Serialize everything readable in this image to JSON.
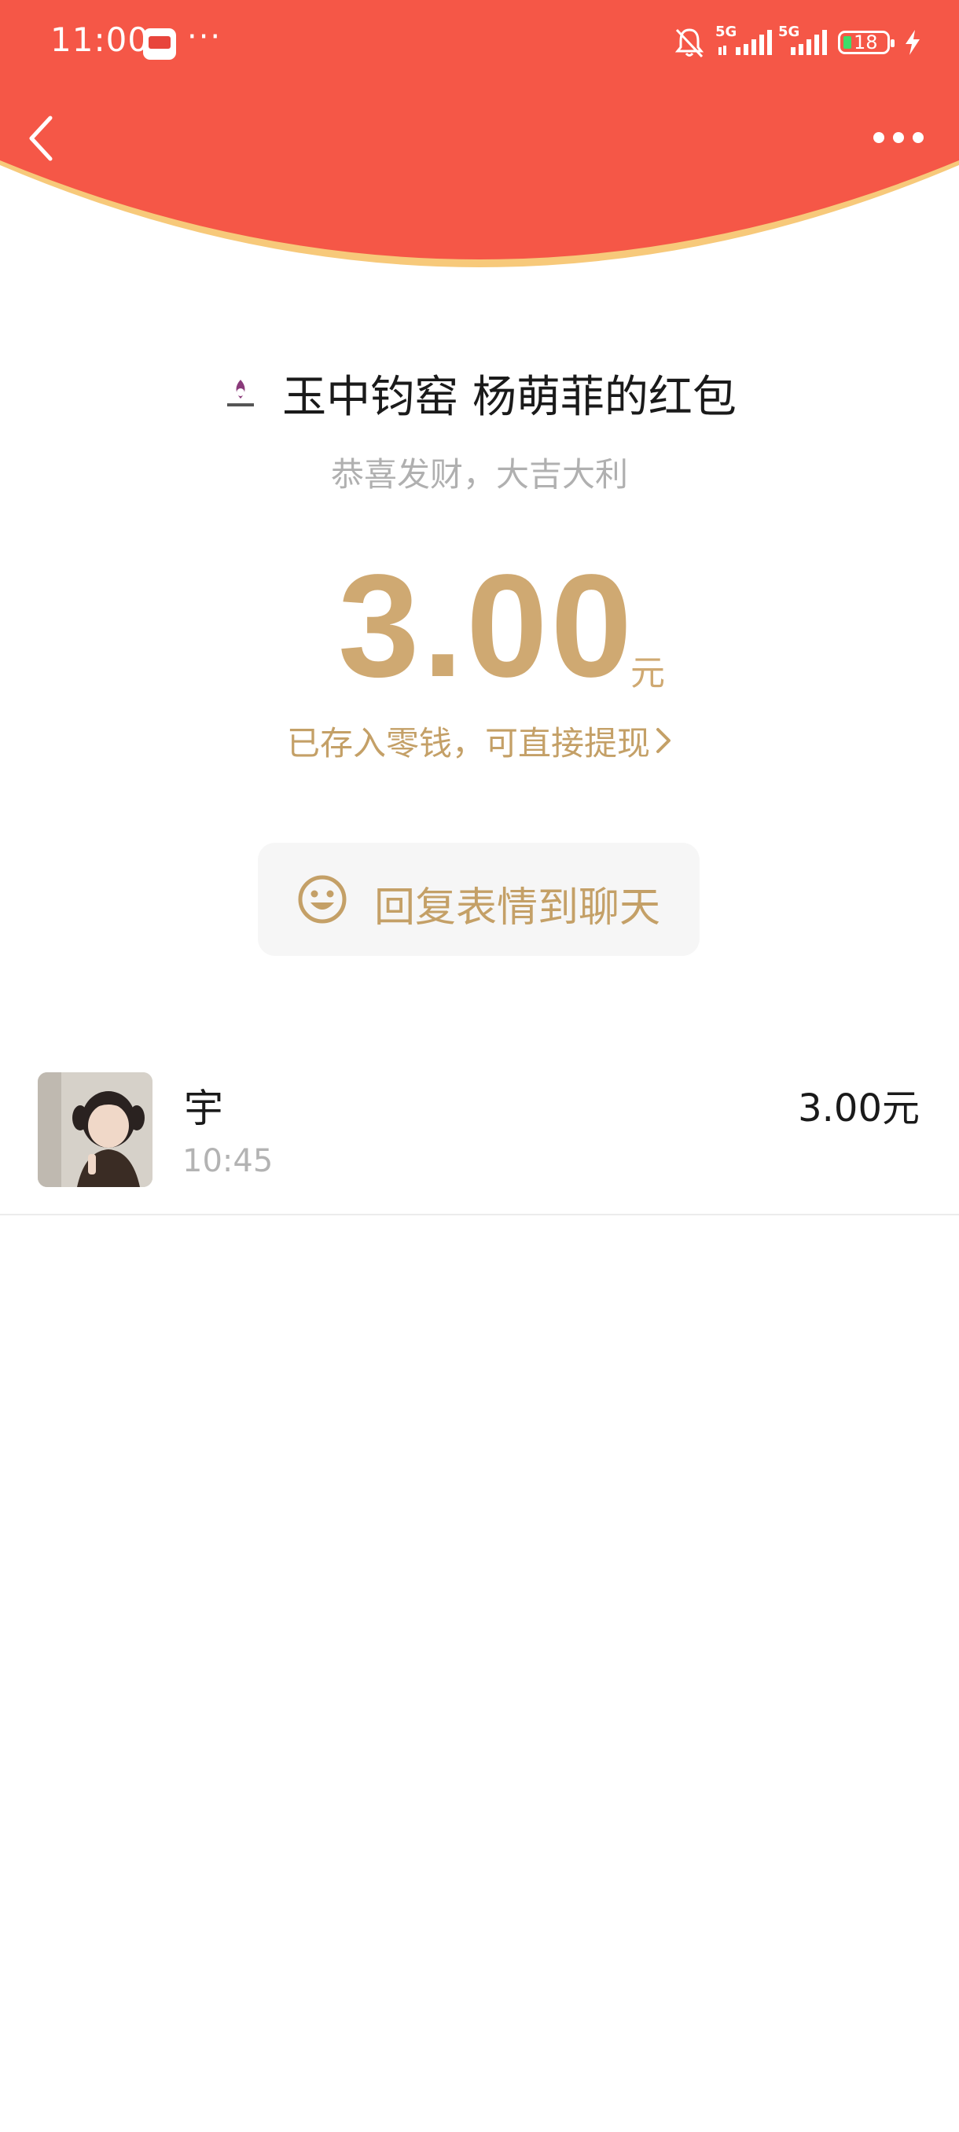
{
  "status_bar": {
    "time": "11:00",
    "overflow": "···",
    "signal1": "5G",
    "signal2": "5G",
    "battery": "18"
  },
  "header": {
    "title": "玉中钧窑 杨萌菲的红包",
    "subtitle": "恭喜发财，大吉大利",
    "back_icon": "back-chevron-icon",
    "more_icon": "more-dots-icon"
  },
  "amount": {
    "value": "3.00",
    "unit": "元",
    "wallet_text": "已存入零钱，可直接提现"
  },
  "reply": {
    "label": "回复表情到聊天",
    "icon": "smile-icon"
  },
  "records": [
    {
      "name": "宇",
      "time": "10:45",
      "amount": "3.00元"
    }
  ],
  "colors": {
    "header_red": "#f55747",
    "gold": "#cfa972",
    "header_rim": "#f7c97a"
  }
}
